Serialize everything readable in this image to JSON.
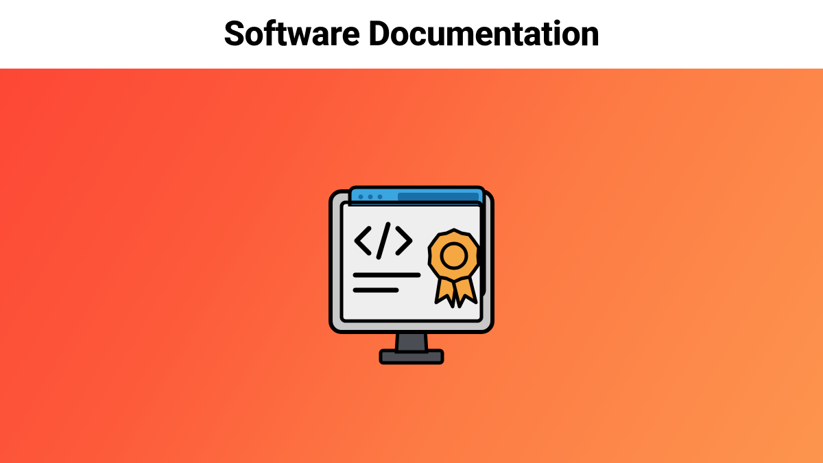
{
  "header": {
    "title": "Software Documentation"
  },
  "hero": {
    "illustration": {
      "name": "computer-code-certificate-icon",
      "description": "Monitor with browser window showing code symbol, text lines, and award ribbon badge"
    }
  },
  "colors": {
    "headerBg": "#ffffff",
    "titleText": "#000000",
    "gradientStart": "#fd4736",
    "gradientEnd": "#fd954e",
    "browserBar": "#3ba5e0",
    "browserBarDark": "#1a6fa8",
    "monitorScreen": "#efeeee",
    "monitorFrame": "#000000",
    "monitorStand": "#4a4e54",
    "badgeOrange": "#f5a742",
    "badgeRibbon": "#f5a742"
  }
}
